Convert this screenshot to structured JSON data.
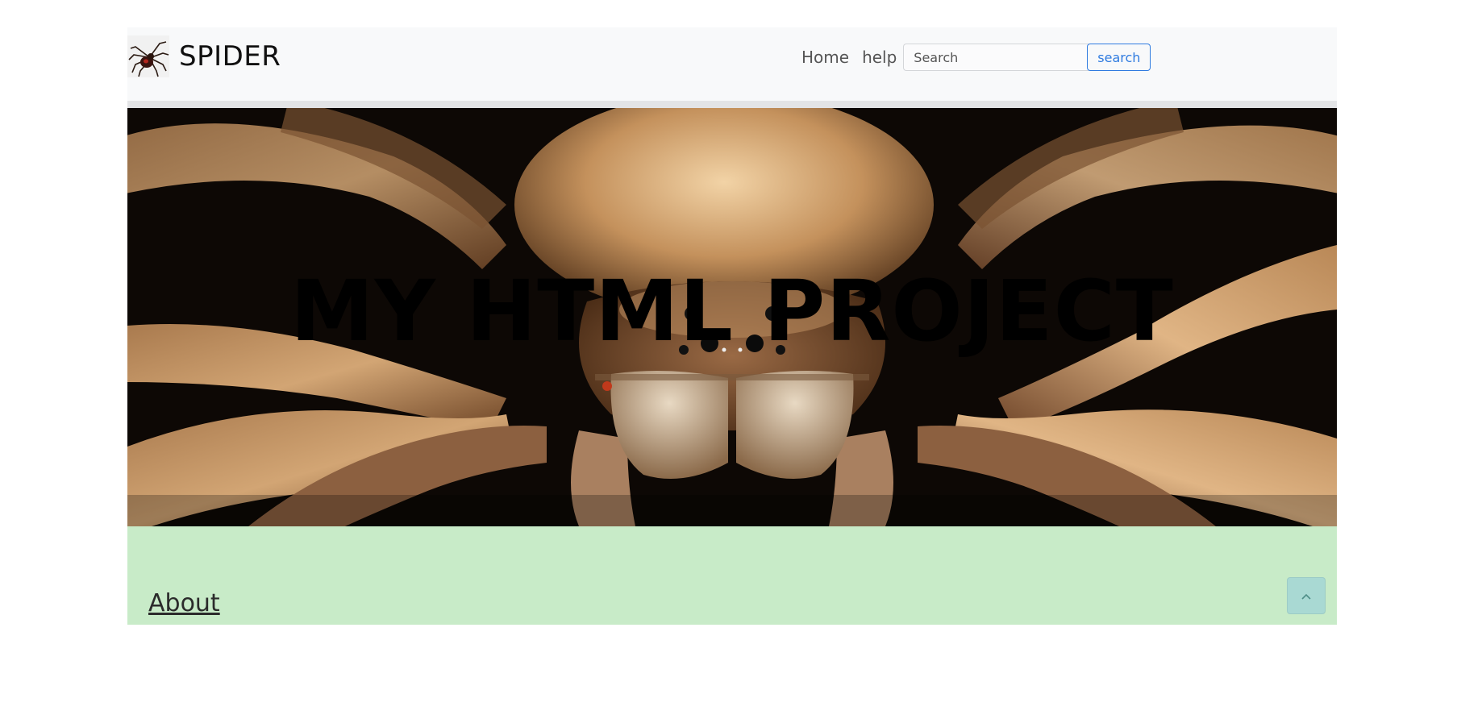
{
  "navbar": {
    "brand": "SPIDER",
    "links": [
      {
        "label": "Home"
      },
      {
        "label": "help"
      }
    ],
    "search": {
      "placeholder": "Search",
      "value": "",
      "button_label": "search"
    }
  },
  "hero": {
    "title": "MY HTML PROJECT"
  },
  "about": {
    "link_label": "About"
  },
  "icons": {
    "brand_logo": "spider-logo-icon",
    "scroll_top": "chevron-up-icon"
  },
  "colors": {
    "navbar_bg": "#f8f9fa",
    "accent": "#2f7be0",
    "about_bg": "#c8ebc8",
    "scroll_button_bg": "#a9d9d3"
  }
}
